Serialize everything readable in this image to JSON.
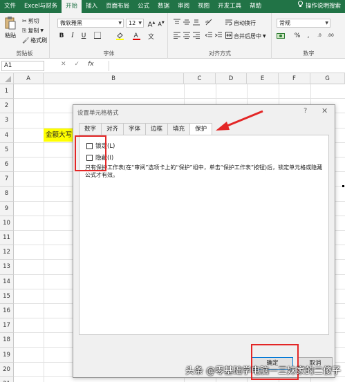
{
  "menu": {
    "tabs": [
      "文件",
      "Excel与财务",
      "开始",
      "插入",
      "页面布局",
      "公式",
      "数据",
      "审阅",
      "视图",
      "开发工具",
      "帮助"
    ],
    "active_index": 2,
    "tell_me": "操作说明搜索"
  },
  "ribbon": {
    "clipboard": {
      "paste": "粘贴",
      "cut": "剪切",
      "copy": "复制",
      "format_painter": "格式刷",
      "label": "剪贴板"
    },
    "font": {
      "name": "微软雅黑",
      "size": "12",
      "label": "字体"
    },
    "alignment": {
      "wrap": "自动换行",
      "merge": "合并后居中",
      "label": "对齐方式"
    },
    "number": {
      "format": "常规",
      "label": "数字"
    }
  },
  "formula_bar": {
    "name_box": "A1",
    "fx": "fx"
  },
  "grid": {
    "columns": [
      "A",
      "B",
      "C",
      "D",
      "E",
      "F",
      "G"
    ],
    "rows": [
      "1",
      "2",
      "3",
      "4",
      "5",
      "6",
      "7",
      "8",
      "9",
      "10",
      "11",
      "12",
      "13",
      "14",
      "15",
      "16",
      "17",
      "18",
      "19",
      "20",
      "21"
    ],
    "cell_b4": "金额大写"
  },
  "dialog": {
    "title": "设置单元格格式",
    "help": "?",
    "close": "✕",
    "tabs": [
      "数字",
      "对齐",
      "字体",
      "边框",
      "填充",
      "保护"
    ],
    "active_tab": 5,
    "locked_label": "锁定(L)",
    "hidden_label": "隐藏(I)",
    "note": "只有保护工作表(在“审阅”选项卡上的“保护”组中，单击“保护工作表”按钮)后，锁定单元格或隐藏公式才有效。",
    "ok": "确定",
    "cancel": "取消"
  },
  "watermark": "头条 @零基础学电脑一三妹家的二傻子",
  "colors": {
    "excel_green": "#217346",
    "highlight": "#ffff00",
    "annotation_red": "#e32626"
  }
}
